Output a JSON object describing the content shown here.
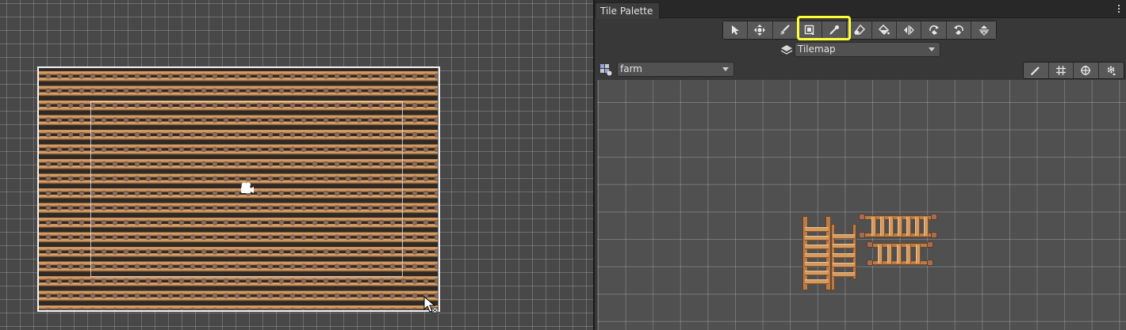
{
  "scene": {
    "description_icons": [
      "camera-gizmo-icon",
      "mouse-pointer-icon"
    ]
  },
  "tile_palette": {
    "tab_title": "Tile Palette",
    "tools": [
      {
        "name": "select-tool",
        "icon": "arrow-pointer-icon"
      },
      {
        "name": "move-tool",
        "icon": "move-arrows-icon"
      },
      {
        "name": "paint-tool",
        "icon": "brush-icon"
      },
      {
        "name": "box-fill-tool",
        "icon": "box-fill-icon",
        "highlighted": true
      },
      {
        "name": "pick-tool",
        "icon": "eyedropper-icon",
        "highlighted": true
      },
      {
        "name": "erase-tool",
        "icon": "eraser-icon"
      },
      {
        "name": "fill-tool",
        "icon": "paint-bucket-icon"
      },
      {
        "name": "flip-x-tool",
        "icon": "flip-horizontal-icon"
      },
      {
        "name": "rotate-cw-tool",
        "icon": "rotate-clockwise-icon"
      },
      {
        "name": "rotate-ccw-tool",
        "icon": "rotate-counterclockwise-icon"
      },
      {
        "name": "flip-y-tool",
        "icon": "flip-vertical-icon"
      }
    ],
    "highlight_color": "#ffff36",
    "active_tilemap": "Tilemap",
    "palette_name": "farm",
    "palette_tools": [
      "edit-pencil-icon",
      "grid-icon",
      "gizmo-icon",
      "settings-gear-icon"
    ]
  }
}
